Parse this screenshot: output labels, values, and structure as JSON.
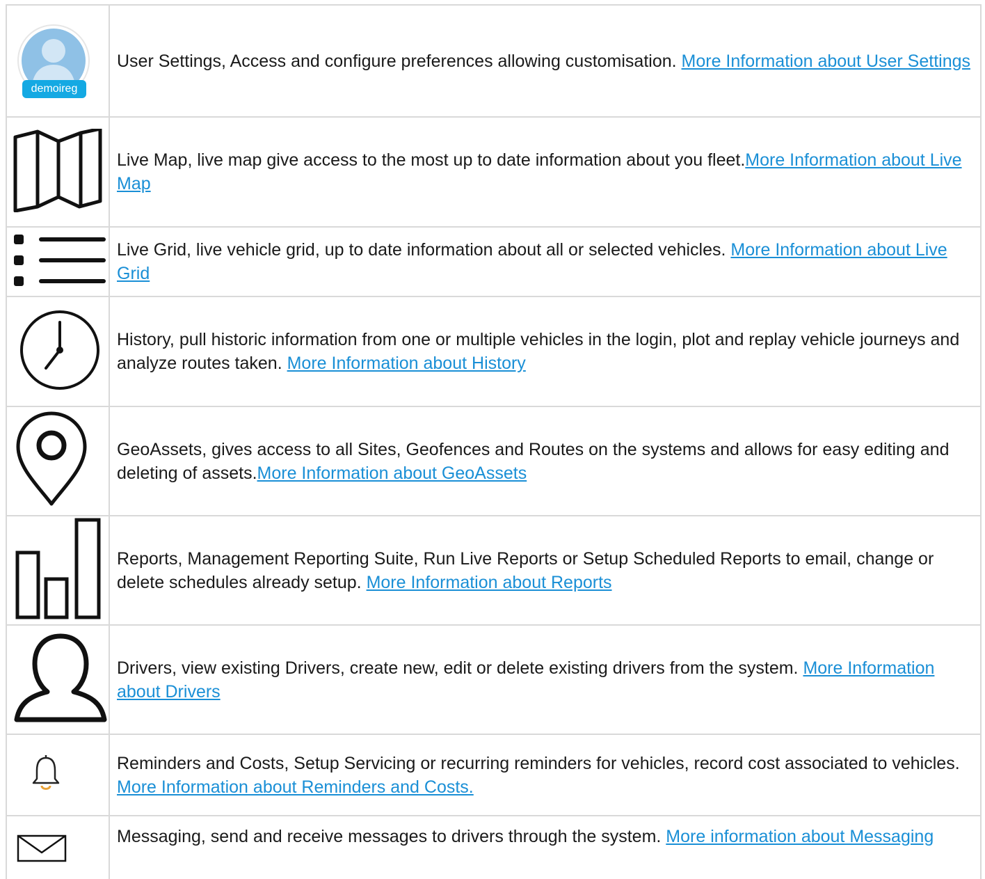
{
  "rows": [
    {
      "icon": "avatar-icon",
      "badge": "demoireg",
      "text": "User Settings, Access and configure preferences allowing customisation. ",
      "link": "More Information about User Settings"
    },
    {
      "icon": "map-icon",
      "text": "Live Map, live map give access to the most up to date information about you fleet.",
      "link": "More Information about Live Map"
    },
    {
      "icon": "list-icon",
      "text": "Live Grid, live vehicle grid, up to date information about all or selected vehicles. ",
      "link": "More Information about Live Grid"
    },
    {
      "icon": "clock-icon",
      "text": "History, pull historic information from one or multiple vehicles in the login, plot and replay vehicle journeys and analyze routes taken. ",
      "link": "More Information about History"
    },
    {
      "icon": "location-pin-icon",
      "text": "GeoAssets, gives access to all Sites, Geofences and Routes on the systems and allows for easy editing and deleting of assets.",
      "link": "More Information about GeoAssets"
    },
    {
      "icon": "bar-chart-icon",
      "text": "Reports, Management Reporting Suite, Run Live Reports or Setup Scheduled Reports to email, change or delete schedules already setup. ",
      "link": "More Information about Reports"
    },
    {
      "icon": "user-icon",
      "text": "Drivers, view existing Drivers, create new, edit or delete existing drivers from the system. ",
      "link": "More Information about Drivers"
    },
    {
      "icon": "bell-icon",
      "text": "Reminders and Costs, Setup Servicing or recurring reminders for vehicles, record cost associated to vehicles. ",
      "link": "More Information about Reminders and Costs."
    },
    {
      "icon": "envelope-icon",
      "text": "Messaging, send and receive messages to drivers through the system. ",
      "link": "More information about Messaging"
    }
  ],
  "colors": {
    "link": "#1a8fd6",
    "border": "#d9d9d9",
    "badge": "#14a9e3",
    "bell": "#e8a23a"
  }
}
